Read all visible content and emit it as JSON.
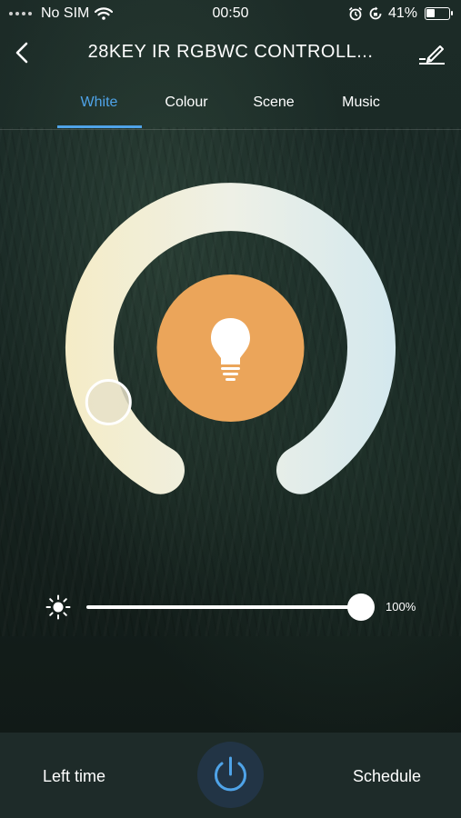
{
  "status_bar": {
    "carrier": "No SIM",
    "time": "00:50",
    "battery_percent": "41%",
    "battery_level": 0.41
  },
  "header": {
    "title": "28KEY IR RGBWC CONTROLL...",
    "back_icon": "chevron-left-icon",
    "edit_icon": "edit-pencil-icon"
  },
  "tabs": [
    {
      "label": "White",
      "active": true
    },
    {
      "label": "Colour",
      "active": false
    },
    {
      "label": "Scene",
      "active": false
    },
    {
      "label": "Music",
      "active": false
    }
  ],
  "color_temp": {
    "level": 0.0,
    "center_color": "#eba55a",
    "warm_color": "#f5ecc6",
    "cool_color": "#d3e8ee",
    "center_icon": "light-bulb-icon"
  },
  "brightness": {
    "label": "100%",
    "value": 100,
    "icon": "sun-icon"
  },
  "bottom_bar": {
    "left_label": "Left time",
    "right_label": "Schedule",
    "power_icon": "power-icon",
    "accent": "#4fa3e8"
  }
}
